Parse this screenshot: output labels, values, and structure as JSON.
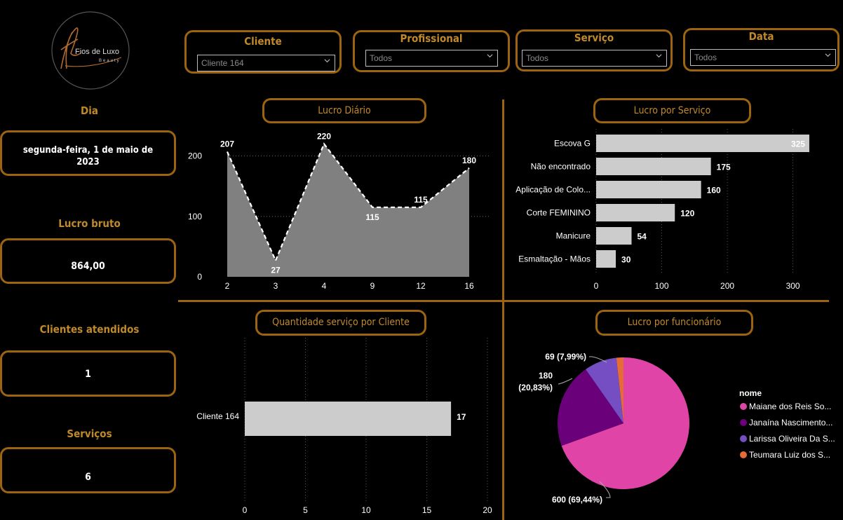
{
  "logo": {
    "name": "Fios de Luxo",
    "sub": "Beauty"
  },
  "filters": [
    {
      "title": "Cliente",
      "value": "Cliente 164"
    },
    {
      "title": "Profissional",
      "value": "Todos"
    },
    {
      "title": "Serviço",
      "value": "Todos"
    },
    {
      "title": "Data",
      "value": "Todos"
    }
  ],
  "kpis": {
    "dia_label": "Dia",
    "dia_line1": "segunda-feira, 1 de maio de",
    "dia_line2": "2023",
    "lucro_label": "Lucro bruto",
    "lucro_value": "864,00",
    "clientes_label": "Clientes atendidos",
    "clientes_value": "1",
    "servicos_label": "Serviços",
    "servicos_value": "6"
  },
  "titles": {
    "lucro_diario": "Lucro Diário",
    "lucro_servico": "Lucro por Serviço",
    "qtd_cliente": "Quantidade serviço por Cliente",
    "lucro_funcionario": "Lucro por funcionário"
  },
  "chart_data": [
    {
      "id": "lucro_diario",
      "type": "area",
      "title": "Lucro Diário",
      "x": [
        "2",
        "3",
        "4",
        "9",
        "12",
        "16"
      ],
      "values": [
        207,
        27,
        220,
        115,
        115,
        180
      ],
      "ylim": [
        0,
        240
      ],
      "yticks": [
        0,
        100,
        200
      ],
      "grid": true,
      "color": "#808080"
    },
    {
      "id": "lucro_servico",
      "type": "bar",
      "orientation": "horizontal",
      "title": "Lucro por Serviço",
      "categories": [
        "Escova G",
        "Não encontrado",
        "Aplicação de Colo...",
        "Corte FEMININO",
        "Manicure",
        "Esmaltação - Mãos"
      ],
      "values": [
        325,
        175,
        160,
        120,
        54,
        30
      ],
      "xlim": [
        0,
        340
      ],
      "xticks": [
        0,
        100,
        200,
        300
      ],
      "grid": true,
      "color": "#cccccc"
    },
    {
      "id": "qtd_cliente",
      "type": "bar",
      "orientation": "horizontal",
      "title": "Quantidade serviço por Cliente",
      "categories": [
        "Cliente 164"
      ],
      "values": [
        17
      ],
      "xlim": [
        0,
        20
      ],
      "xticks": [
        0,
        5,
        10,
        15,
        20
      ],
      "grid": true,
      "color": "#cccccc"
    },
    {
      "id": "lucro_funcionario",
      "type": "pie",
      "title": "Lucro por funcionário",
      "legend_title": "nome",
      "legend_position": "right",
      "labels": [
        "Maiane dos Reis So...",
        "Janaína Nascimento...",
        "Larissa Oliveira Da S...",
        "Teumara Luiz dos  S..."
      ],
      "values": [
        600,
        180,
        69,
        15
      ],
      "data_labels": [
        "600 (69,44%)",
        "180",
        "(20,83%)",
        "69 (7,99%)"
      ],
      "colors": [
        "#e044a7",
        "#6b007b",
        "#744ec2",
        "#e66c37"
      ]
    }
  ]
}
